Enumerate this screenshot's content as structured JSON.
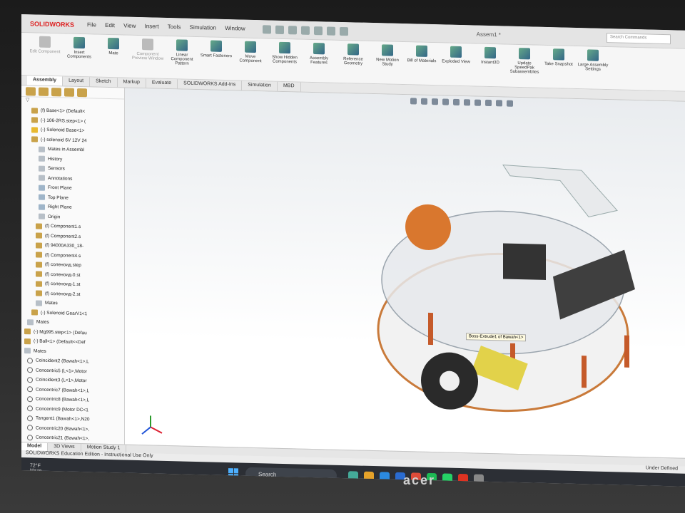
{
  "app": {
    "brand": "SOLIDWORKS",
    "document": "Assem1 *"
  },
  "menu": [
    "File",
    "Edit",
    "View",
    "Insert",
    "Tools",
    "Simulation",
    "Window"
  ],
  "search_placeholder": "Search Commands",
  "ribbon": [
    {
      "label": "Edit Component",
      "enabled": false
    },
    {
      "label": "Insert Components",
      "enabled": true
    },
    {
      "label": "Mate",
      "enabled": true
    },
    {
      "label": "Component Preview Window",
      "enabled": false
    },
    {
      "label": "Linear Component Pattern",
      "enabled": true
    },
    {
      "label": "Smart Fasteners",
      "enabled": true
    },
    {
      "label": "Move Component",
      "enabled": true
    },
    {
      "label": "Show Hidden Components",
      "enabled": true
    },
    {
      "label": "Assembly Features",
      "enabled": true
    },
    {
      "label": "Reference Geometry",
      "enabled": true
    },
    {
      "label": "New Motion Study",
      "enabled": true
    },
    {
      "label": "Bill of Materials",
      "enabled": true
    },
    {
      "label": "Exploded View",
      "enabled": true
    },
    {
      "label": "Instant3D",
      "enabled": true
    },
    {
      "label": "Update SpeedPak Subassemblies",
      "enabled": true
    },
    {
      "label": "Take Snapshot",
      "enabled": true
    },
    {
      "label": "Large Assembly Settings",
      "enabled": true
    }
  ],
  "tabs": [
    "Assembly",
    "Layout",
    "Sketch",
    "Markup",
    "Evaluate",
    "SOLIDWORKS Add-Ins",
    "Simulation",
    "MBD"
  ],
  "tree": [
    {
      "label": "(f) Base<1> (Default<",
      "icon": "part"
    },
    {
      "label": "(-) 106-2RS.step<1> (",
      "icon": "part"
    },
    {
      "label": "(-) Solenoid Base<1>",
      "icon": "warn"
    },
    {
      "label": "(-) solenoid 6V 12V 24",
      "icon": "part"
    },
    {
      "label": "Mates in Assembl",
      "icon": "folder"
    },
    {
      "label": "History",
      "icon": "folder"
    },
    {
      "label": "Sensors",
      "icon": "folder"
    },
    {
      "label": "Annotations",
      "icon": "folder"
    },
    {
      "label": "Front Plane",
      "icon": "plane"
    },
    {
      "label": "Top Plane",
      "icon": "plane"
    },
    {
      "label": "Right Plane",
      "icon": "plane"
    },
    {
      "label": "Origin",
      "icon": "folder"
    },
    {
      "label": "(f) Component1.s",
      "icon": "part"
    },
    {
      "label": "(f) Component2.s",
      "icon": "part"
    },
    {
      "label": "(f) 94000A330_18-",
      "icon": "part"
    },
    {
      "label": "(f) Component4.s",
      "icon": "part"
    },
    {
      "label": "(f) соленоид.step",
      "icon": "part"
    },
    {
      "label": "(f) соленоид-0.st",
      "icon": "part"
    },
    {
      "label": "(f) соленоид-1.st",
      "icon": "part"
    },
    {
      "label": "(f) соленоид-2.st",
      "icon": "part"
    },
    {
      "label": "Mates",
      "icon": "folder"
    },
    {
      "label": "(-) Solenoid GearV1<1",
      "icon": "part"
    },
    {
      "label": "Mates",
      "icon": "folder"
    },
    {
      "label": "(-) Mg995.step<1> (Defau",
      "icon": "part"
    },
    {
      "label": "(-) Ball<1> (Default<<Def",
      "icon": "part"
    },
    {
      "label": "Mates",
      "icon": "folder"
    },
    {
      "label": "Coincident2 (Bawah<1>,L",
      "icon": "mate"
    },
    {
      "label": "Concentric5 (L<1>,Motor",
      "icon": "mate"
    },
    {
      "label": "Coincident3 (L<1>,Motor",
      "icon": "mate"
    },
    {
      "label": "Concentric7 (Bawah<1>,L",
      "icon": "mate"
    },
    {
      "label": "Concentric8 (Bawah<1>,L",
      "icon": "mate"
    },
    {
      "label": "Concentric9 (Motor DC<1",
      "icon": "mate"
    },
    {
      "label": "Tangent1 (Bawah<1>,N20",
      "icon": "mate"
    },
    {
      "label": "Concentric20 (Bawah<1>,",
      "icon": "mate"
    },
    {
      "label": "Concentric21 (Bawah<1>,",
      "icon": "mate"
    }
  ],
  "tooltip": "Boss-Extrude1 of Bawah<1>",
  "bottom_tabs": [
    "Model",
    "3D Views",
    "Motion Study 1"
  ],
  "status": {
    "left": "SOLIDWORKS Education Edition - Instructional Use Only",
    "right": "Under Defined"
  },
  "taskbar": {
    "weather_temp": "72°F",
    "weather_desc": "Haze",
    "search": "Search"
  },
  "monitor_brand": "acer"
}
